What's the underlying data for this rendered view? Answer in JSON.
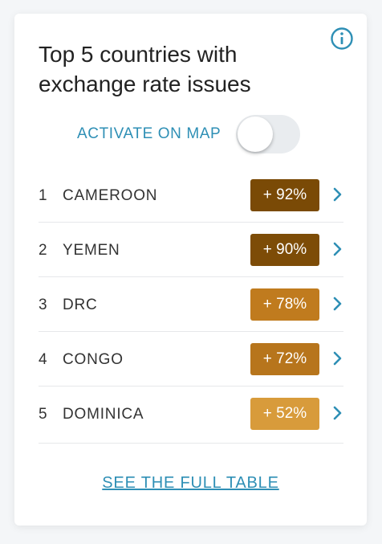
{
  "widget": {
    "title": "Top 5 countries with exchange rate issues",
    "info_icon": "info-circle-icon",
    "toggle": {
      "label": "ACTIVATE ON MAP",
      "state": "off"
    },
    "rows": [
      {
        "rank": "1",
        "country": "CAMEROON",
        "value": "+ 92%",
        "color": "#7a4a06"
      },
      {
        "rank": "2",
        "country": "YEMEN",
        "value": "+ 90%",
        "color": "#7d4c07"
      },
      {
        "rank": "3",
        "country": "DRC",
        "value": "+ 78%",
        "color": "#c07b1e"
      },
      {
        "rank": "4",
        "country": "CONGO",
        "value": "+ 72%",
        "color": "#b7751c"
      },
      {
        "rank": "5",
        "country": "DOMINICA",
        "value": "+ 52%",
        "color": "#d89b3b"
      }
    ],
    "full_table_link": "SEE THE FULL TABLE",
    "accent_color": "#2e8fb5"
  }
}
